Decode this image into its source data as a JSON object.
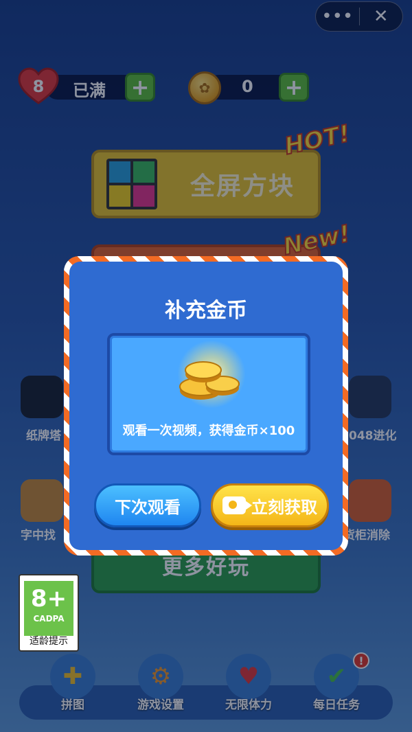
{
  "colors": {
    "accent_orange": "#f36b24",
    "dialog_blue": "#2f6bd1",
    "plus_green": "#5fbf3a",
    "get_yellow": "#f4b618",
    "later_blue": "#1f86f0"
  },
  "capsule": {
    "more_icon": "more-dots-icon",
    "close_icon": "close-icon"
  },
  "resources": {
    "hearts_count": "8",
    "hearts_status": "已满",
    "coins": "0"
  },
  "menu": {
    "fullscreen_label": "全屏方块",
    "hot_tag": "HOT!",
    "new_tag": "New!",
    "more_games_label": "更多好玩"
  },
  "side": {
    "left1": "纸牌塔",
    "left2": "字中找",
    "right1": "048进化",
    "right2": "货柜消除"
  },
  "rating": {
    "age": "8+",
    "org": "CADPA",
    "hint": "适龄提示"
  },
  "nav": [
    {
      "label": "拼图",
      "icon": "puzzle-icon"
    },
    {
      "label": "游戏设置",
      "icon": "gear-icon"
    },
    {
      "label": "无限体力",
      "icon": "infinity-heart-icon"
    },
    {
      "label": "每日任务",
      "icon": "clipboard-check-icon",
      "badge": "!"
    }
  ],
  "dialog": {
    "title": "补充金币",
    "reward_text": "观看一次视频，获得金币×100",
    "later_label": "下次观看",
    "get_label": "立刻获取"
  }
}
